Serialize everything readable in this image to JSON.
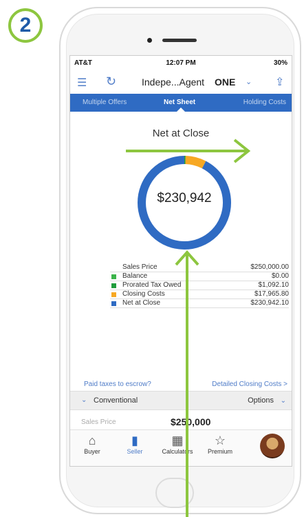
{
  "step_number": "2",
  "status_bar": {
    "carrier": "AT&T",
    "time": "12:07 PM",
    "battery": "30%"
  },
  "navbar": {
    "title": "Indepe...Agent",
    "brand": "ONE"
  },
  "tabs": [
    {
      "label": "Multiple Offers"
    },
    {
      "label": "Net Sheet"
    },
    {
      "label": "Holding Costs"
    }
  ],
  "heading": "Net at Close",
  "center_value": "$230,942",
  "legend": [
    {
      "label": "Sales Price",
      "value": "$250,000.00",
      "color": ""
    },
    {
      "label": "Balance",
      "value": "$0.00",
      "color": "#3cb44a"
    },
    {
      "label": "Prorated Tax Owed",
      "value": "$1,092.10",
      "color": "#1f9c3c"
    },
    {
      "label": "Closing Costs",
      "value": "$17,965.80",
      "color": "#f7a823"
    },
    {
      "label": "Net at Close",
      "value": "$230,942.10",
      "color": "#2f6bc3"
    }
  ],
  "chart_data": {
    "type": "pie",
    "title": "Net at Close",
    "categories": [
      "Balance",
      "Prorated Tax Owed",
      "Closing Costs",
      "Net at Close"
    ],
    "values": [
      0,
      1092.1,
      17965.8,
      230942.1
    ],
    "colors": [
      "#3cb44a",
      "#1f9c3c",
      "#f7a823",
      "#2f6bc3"
    ]
  },
  "links": {
    "left": "Paid taxes to escrow?",
    "right": "Detailed Closing Costs >"
  },
  "loan": {
    "type": "Conventional",
    "options": "Options"
  },
  "price": {
    "label": "Sales Price",
    "value": "$250,000"
  },
  "bottom_nav": [
    {
      "label": "Buyer",
      "icon": "house-icon"
    },
    {
      "label": "Seller",
      "icon": "sign-icon"
    },
    {
      "label": "Calculators",
      "icon": "calculator-icon"
    },
    {
      "label": "Premium",
      "icon": "star-icon"
    }
  ],
  "accent_color": "#8dc63f"
}
